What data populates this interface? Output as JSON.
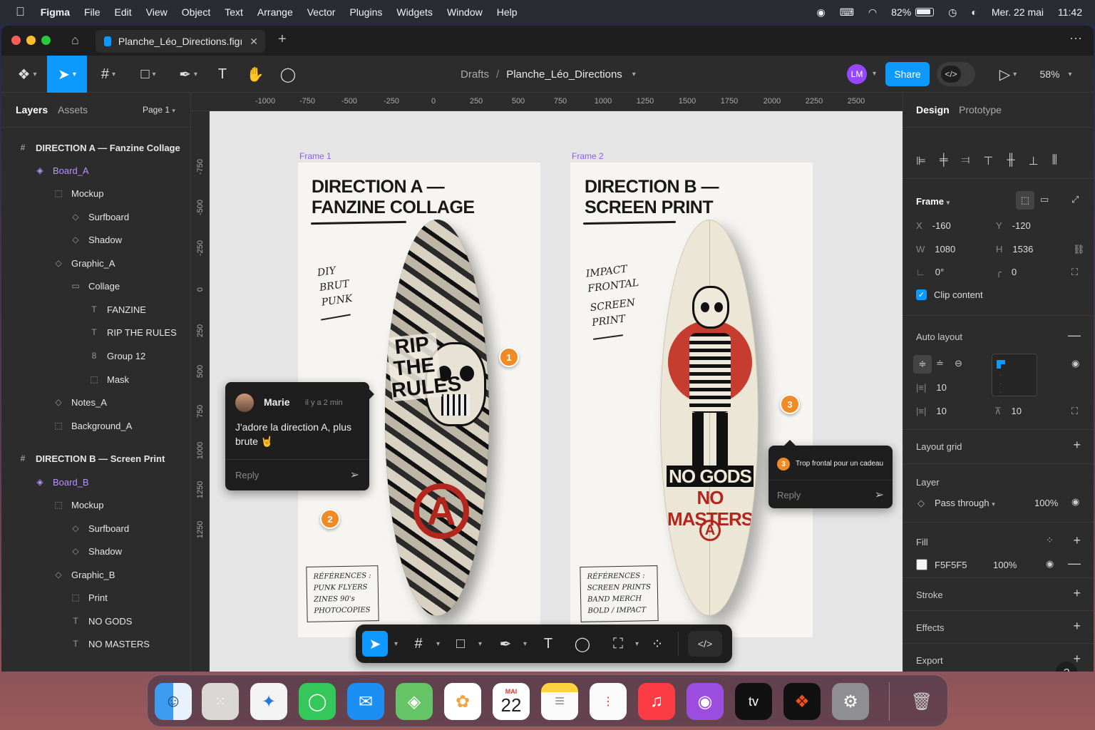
{
  "menubar": {
    "app": "Figma",
    "items": [
      "File",
      "Edit",
      "View",
      "Object",
      "Text",
      "Arrange",
      "Vector",
      "Plugins",
      "Widgets",
      "Window",
      "Help"
    ],
    "battery": "82%",
    "date": "Mer. 22 mai",
    "time": "11:42"
  },
  "tab": {
    "title": "Planche_Léo_Directions.figı"
  },
  "breadcrumb": {
    "drafts": "Drafts",
    "sep": "/",
    "file": "Planche_Léo_Directions"
  },
  "toolbar": {
    "avatar": "LM",
    "share": "Share",
    "zoom": "58%"
  },
  "leftpanel": {
    "tabs": [
      "Layers",
      "Assets"
    ],
    "page": "Page 1",
    "layers": [
      {
        "label": "DIRECTION A — Fanzine Collage",
        "icon": "#",
        "indent": 0,
        "kind": "frame"
      },
      {
        "label": "Board_A",
        "icon": "◈",
        "indent": 1,
        "kind": "comp"
      },
      {
        "label": "Mockup",
        "icon": "⬚",
        "indent": 2,
        "kind": "n"
      },
      {
        "label": "Surfboard",
        "icon": "◇",
        "indent": 3,
        "kind": "n"
      },
      {
        "label": "Shadow",
        "icon": "◇",
        "indent": 3,
        "kind": "n"
      },
      {
        "label": "Graphic_A",
        "icon": "◇",
        "indent": 2,
        "kind": "n"
      },
      {
        "label": "Collage",
        "icon": "▭",
        "indent": 3,
        "kind": "n"
      },
      {
        "label": "FANZINE",
        "icon": "T",
        "indent": 4,
        "kind": "n"
      },
      {
        "label": "RIP THE RULES",
        "icon": "T",
        "indent": 4,
        "kind": "n"
      },
      {
        "label": "Group 12",
        "icon": "8",
        "indent": 4,
        "kind": "n"
      },
      {
        "label": "Mask",
        "icon": "⬚",
        "indent": 4,
        "kind": "n"
      },
      {
        "label": "Notes_A",
        "icon": "◇",
        "indent": 2,
        "kind": "n"
      },
      {
        "label": "Background_A",
        "icon": "⬚",
        "indent": 2,
        "kind": "n"
      },
      {
        "label": "DIRECTION B — Screen Print",
        "icon": "#",
        "indent": 0,
        "kind": "frame"
      },
      {
        "label": "Board_B",
        "icon": "◈",
        "indent": 1,
        "kind": "comp"
      },
      {
        "label": "Mockup",
        "icon": "⬚",
        "indent": 2,
        "kind": "n"
      },
      {
        "label": "Surfboard",
        "icon": "◇",
        "indent": 3,
        "kind": "n"
      },
      {
        "label": "Shadow",
        "icon": "◇",
        "indent": 3,
        "kind": "n"
      },
      {
        "label": "Graphic_B",
        "icon": "◇",
        "indent": 2,
        "kind": "n"
      },
      {
        "label": "Print",
        "icon": "⬚",
        "indent": 3,
        "kind": "n"
      },
      {
        "label": "NO GODS",
        "icon": "T",
        "indent": 3,
        "kind": "n"
      },
      {
        "label": "NO MASTERS",
        "icon": "T",
        "indent": 3,
        "kind": "n"
      }
    ]
  },
  "rulers": {
    "top": [
      "-1000",
      "-750",
      "-500",
      "-250",
      "0",
      "250",
      "500",
      "750",
      "1000",
      "1250",
      "1500",
      "1750",
      "2000",
      "2250",
      "2500"
    ],
    "left": [
      "-750",
      "-500",
      "-250",
      "0",
      "250",
      "500",
      "750",
      "1000",
      "1250",
      "1250"
    ]
  },
  "canvas": {
    "frame1": {
      "label": "Frame 1",
      "title1": "DIRECTION A —",
      "title2": "FANZINE COLLAGE",
      "notes": [
        "DIY",
        "BRUT",
        "PUNK"
      ],
      "refs": [
        "RÉFÉRENCES :",
        "PUNK FLYERS",
        "ZINES 90's",
        "PHOTOCOPIES"
      ],
      "board_text": [
        "RIP",
        "THE",
        "RULES"
      ]
    },
    "frame2": {
      "label": "Frame 2",
      "title1": "DIRECTION B —",
      "title2": "SCREEN PRINT",
      "notes": [
        "IMPACT",
        "FRONTAL",
        "SCREEN",
        "PRINT"
      ],
      "refs": [
        "RÉFÉRENCES :",
        "SCREEN PRINTS",
        "BAND MERCH",
        "BOLD / IMPACT"
      ],
      "board_text": [
        "NO GODS",
        "NO MASTERS"
      ]
    },
    "pins": [
      "1",
      "2",
      "3"
    ],
    "comment1": {
      "author": "Marie",
      "time": "il y a 2 min",
      "text": "J'adore la direction A, plus brute 🤘",
      "reply": "Reply"
    },
    "comment3": {
      "num": "3",
      "text": "Trop frontal pour un cadeau",
      "reply": "Reply"
    }
  },
  "rightpanel": {
    "tabs": [
      "Design",
      "Prototype"
    ],
    "frame_label": "Frame",
    "x_label": "X",
    "x": "-160",
    "y_label": "Y",
    "y": "-120",
    "w_label": "W",
    "w": "1080",
    "h_label": "H",
    "h": "1536",
    "rotation": "0°",
    "radius": "0",
    "clip": "Clip content",
    "auto_layout": "Auto layout",
    "gap1": "10",
    "gap2": "10",
    "pad": "10",
    "layout_grid": "Layout grid",
    "layer": "Layer",
    "blend": "Pass through",
    "opacity": "100%",
    "fill": "Fill",
    "fill_hex": "F5F5F5",
    "fill_opacity": "100%",
    "fill_color": "#F5F5F5",
    "stroke": "Stroke",
    "effects": "Effects",
    "export": "Export",
    "help": "?"
  },
  "dock": {
    "calendar_month": "MAI",
    "calendar_day": "22",
    "tv": "tv"
  },
  "colors": {
    "accent": "#0d99ff",
    "component": "#b892ff",
    "pin": "#f08a24",
    "avatar": "#9747ff"
  }
}
